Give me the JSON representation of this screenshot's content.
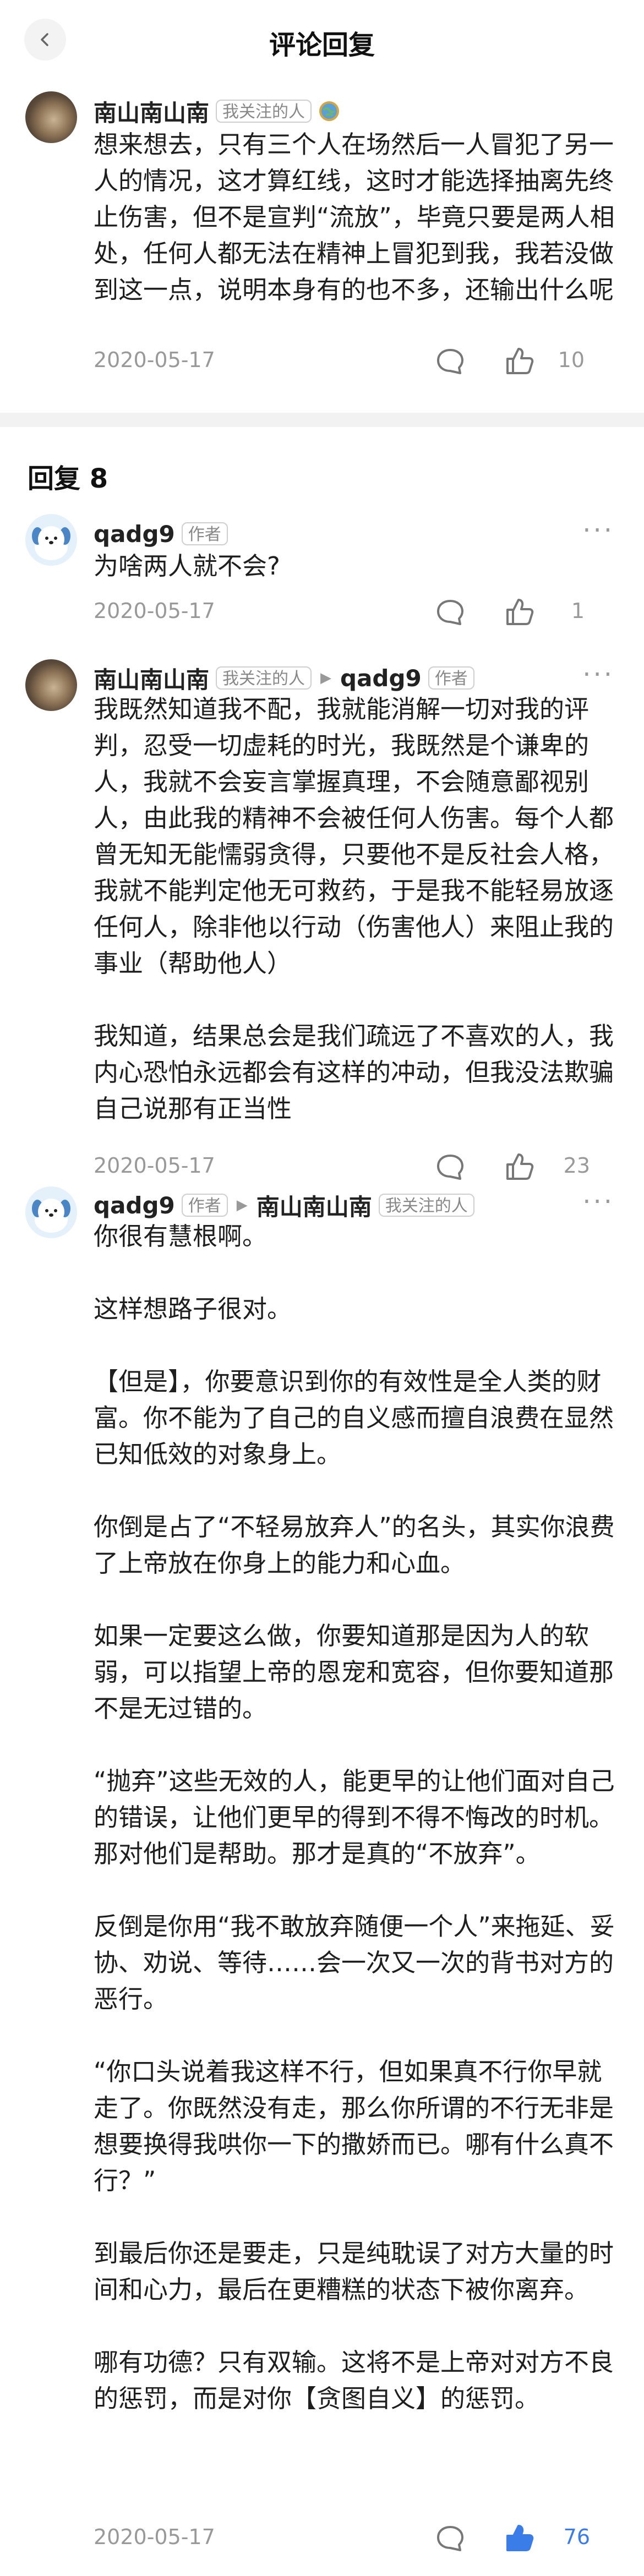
{
  "header": {
    "title": "评论回复"
  },
  "main_comment": {
    "author": "南山南山南",
    "badge": "我关注的人",
    "text": "想来想去，只有三个人在场然后一人冒犯了另一人的情况，这才算红线，这时才能选择抽离先终止伤害，但不是宣判“流放”，毕竟只要是两人相处，任何人都无法在精神上冒犯到我，我若没做到这一点，说明本身有的也不多，还输出什么呢",
    "date": "2020-05-17",
    "likes": "10"
  },
  "replies_header": {
    "label": "回复 8"
  },
  "replies": [
    {
      "author": "qadg9",
      "author_badge": "作者",
      "text": "为啥两人就不会?",
      "date": "2020-05-17",
      "likes": "1"
    },
    {
      "author": "南山南山南",
      "author_badge": "我关注的人",
      "reply_to": "qadg9",
      "reply_to_badge": "作者",
      "text": "我既然知道我不配，我就能消解一切对我的评判，忍受一切虚耗的时光，我既然是个谦卑的人，我就不会妄言掌握真理，不会随意鄙视别人，由此我的精神不会被任何人伤害。每个人都曾无知无能懦弱贪得，只要他不是反社会人格，我就不能判定他无可救药，于是我不能轻易放逐任何人，除非他以行动（伤害他人）来阻止我的事业（帮助他人）\n\n我知道，结果总会是我们疏远了不喜欢的人，我内心恐怕永远都会有这样的冲动，但我没法欺骗自己说那有正当性",
      "date": "2020-05-17",
      "likes": "23"
    },
    {
      "author": "qadg9",
      "author_badge": "作者",
      "reply_to": "南山南山南",
      "reply_to_badge": "我关注的人",
      "text": "你很有慧根啊。\n\n这样想路子很对。\n\n【但是】，你要意识到你的有效性是全人类的财富。你不能为了自己的自义感而擅自浪费在显然已知低效的对象身上。\n\n你倒是占了“不轻易放弃人”的名头，其实你浪费了上帝放在你身上的能力和心血。\n\n如果一定要这么做，你要知道那是因为人的软弱，可以指望上帝的恩宠和宽容，但你要知道那不是无过错的。\n\n“抛弃”这些无效的人，能更早的让他们面对自己的错误，让他们更早的得到不得不悔改的时机。那对他们是帮助。那才是真的“不放弃”。\n\n反倒是你用“我不敢放弃随便一个人”来拖延、妥协、劝说、等待……会一次又一次的背书对方的恶行。\n\n“你口头说着我这样不行，但如果真不行你早就走了。你既然没有走，那么你所谓的不行无非是想要换得我哄你一下的撒娇而已。哪有什么真不行？”\n\n到最后你还是要走，只是纯耽误了对方大量的时间和心力，最后在更糟糕的状态下被你离弃。\n\n哪有功德？只有双输。这将不是上帝对对方不良的惩罚，而是对你【贪图自义】的惩罚。",
      "date": "2020-05-17",
      "likes": "76",
      "liked": true
    }
  ],
  "colors": {
    "accent": "#3a7ce8",
    "muted": "#999999",
    "divider": "#f2f2f2"
  },
  "icons": {
    "back": "chevron-left-icon",
    "comment": "comment-bubble-icon",
    "like": "thumbs-up-icon",
    "more": "more-dots-icon",
    "reply_arrow": "triangle-right-icon",
    "globe": "globe-icon"
  }
}
